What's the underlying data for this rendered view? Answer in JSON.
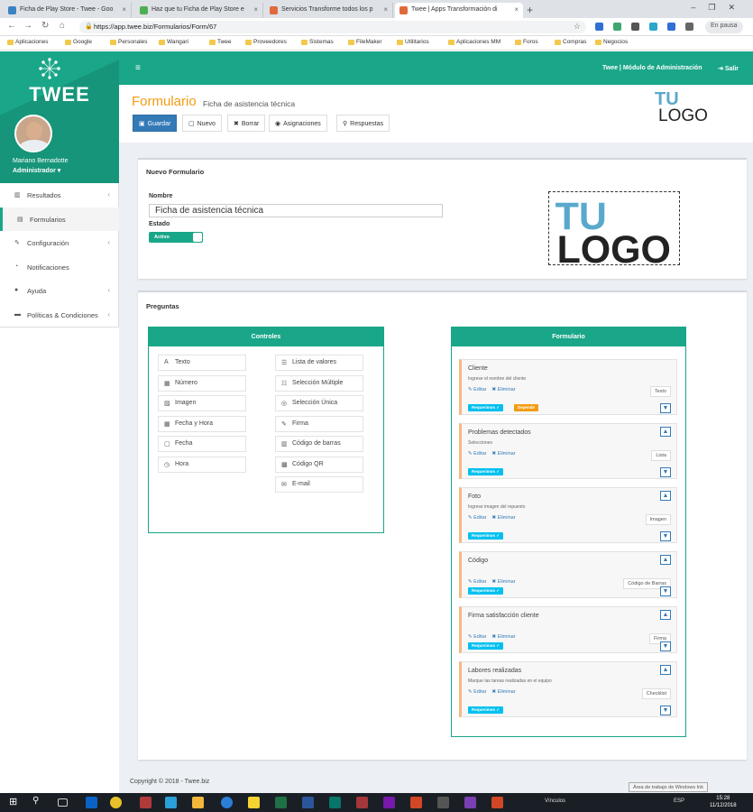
{
  "browser": {
    "tabs": [
      {
        "title": "Ficha de Play Store - Twee - Goo",
        "color": "#3b82c4"
      },
      {
        "title": "Haz que tu Ficha de Play Store e",
        "color": "#4caf50"
      },
      {
        "title": "Servicios Transforme todos los p",
        "color": "#e06a3c"
      },
      {
        "title": "Twee | Apps Transformación di",
        "color": "#e06a3c"
      }
    ],
    "url": "https://app.twee.biz/Formularios/Form/67",
    "incognito_label": "En pausa",
    "bookmarks": [
      "Aplicaciones",
      "Google",
      "Personales",
      "Wangari",
      "Twee",
      "Proveedores",
      "Sistemas",
      "FileMaker",
      "Utilitarios",
      "Aplicaciones MM",
      "Foros",
      "Compras",
      "Negocios"
    ]
  },
  "sidebar": {
    "brand": "TWEE",
    "user_name": "Mariano Bernadotte",
    "user_role": "Administrador ▾",
    "items": [
      {
        "label": "Resultados",
        "icon": "bar-chart-icon",
        "glyph": "▥",
        "caret": "‹"
      },
      {
        "label": "Formularios",
        "icon": "file-icon",
        "glyph": "▤",
        "caret": ""
      },
      {
        "label": "Configuración",
        "icon": "wrench-icon",
        "glyph": "✎",
        "caret": "‹"
      },
      {
        "label": "Notificaciones",
        "icon": "bell-icon",
        "glyph": "◔",
        "caret": ""
      },
      {
        "label": "Ayuda",
        "icon": "info-icon",
        "glyph": "●",
        "caret": "‹"
      },
      {
        "label": "Políticas & Condiciones",
        "icon": "briefcase-icon",
        "glyph": "▬",
        "caret": "‹"
      }
    ]
  },
  "topnav": {
    "menu_icon": "≡",
    "title": "Twee | Módulo de Administración",
    "logout": "Salir"
  },
  "page": {
    "title": "Formulario",
    "subtitle": "Ficha de asistencia técnica",
    "toolbar": [
      {
        "label": "Guardar",
        "icon": "save-icon",
        "glyph": "▣",
        "primary": true
      },
      {
        "label": "Nuevo",
        "icon": "new-file-icon",
        "glyph": "▢",
        "primary": false
      },
      {
        "label": "Borrar",
        "icon": "delete-icon",
        "glyph": "✖",
        "primary": false
      },
      {
        "label": "Asignaciones",
        "icon": "user-icon",
        "glyph": "◉",
        "primary": false
      },
      {
        "label": "Respuestas",
        "icon": "search-icon",
        "glyph": "⚲",
        "primary": false
      }
    ],
    "logo_text_top": "TU",
    "logo_text_bottom": "LOGO"
  },
  "form_panel": {
    "title": "Nuevo Formulario",
    "name_label": "Nombre",
    "name_value": "Ficha de asistencia técnica",
    "state_label": "Estado",
    "state_value": "Activo"
  },
  "questions_panel": {
    "title": "Preguntas",
    "controls_title": "Controles",
    "form_title": "Formulario",
    "controls_left": [
      {
        "label": "Texto",
        "icon": "font-icon",
        "glyph": "A"
      },
      {
        "label": "Número",
        "icon": "calculator-icon",
        "glyph": "▦"
      },
      {
        "label": "Imagen",
        "icon": "image-icon",
        "glyph": "▨"
      },
      {
        "label": "Fecha y Hora",
        "icon": "calendar-icon",
        "glyph": "▦"
      },
      {
        "label": "Fecha",
        "icon": "calendar-blank-icon",
        "glyph": "▢"
      },
      {
        "label": "Hora",
        "icon": "clock-icon",
        "glyph": "◷"
      }
    ],
    "controls_right": [
      {
        "label": "Lista de valores",
        "icon": "list-icon",
        "glyph": "☰"
      },
      {
        "label": "Selección Múltiple",
        "icon": "checklist-icon",
        "glyph": "☷"
      },
      {
        "label": "Selección Única",
        "icon": "radio-icon",
        "glyph": "◎"
      },
      {
        "label": "Firma",
        "icon": "pencil-icon",
        "glyph": "✎"
      },
      {
        "label": "Código de barras",
        "icon": "barcode-icon",
        "glyph": "▥"
      },
      {
        "label": "Código QR",
        "icon": "qrcode-icon",
        "glyph": "▩"
      },
      {
        "label": "E-mail",
        "icon": "envelope-icon",
        "glyph": "✉"
      }
    ],
    "edit_label": "Editar",
    "delete_label": "Eliminar",
    "required_label": "Requerimos ✓",
    "depends_label": "Depende",
    "questions": [
      {
        "title": "Cliente",
        "desc": "Ingrese el nombre del cliente",
        "type": "Texto",
        "depends": true,
        "up": false
      },
      {
        "title": "Problemas detectados",
        "desc": "Selecciones",
        "type": "Lista",
        "depends": false,
        "up": true
      },
      {
        "title": "Foto",
        "desc": "Ingrese imagen del repuesto",
        "type": "Imagen",
        "depends": false,
        "up": true
      },
      {
        "title": "Código",
        "desc": "",
        "type": "Código de Barras",
        "depends": false,
        "up": true
      },
      {
        "title": "Firma satisfacción cliente",
        "desc": "",
        "type": "Firma",
        "depends": false,
        "up": true
      },
      {
        "title": "Labores realizadas",
        "desc": "Marque las tareas realizadas en el equipo",
        "type": "Checklist",
        "depends": false,
        "up": true
      }
    ]
  },
  "footer": "Copyright © 2018 - Twee.biz",
  "taskbar": {
    "tray_text": "Vínculos",
    "lang": "ESP",
    "time": "15:28",
    "date": "11/12/2018",
    "toast": "Área de trabajo de Windows Ink"
  },
  "colors": {
    "primary": "#1aa688",
    "accent": "#f39c12",
    "button": "#337ab7"
  }
}
